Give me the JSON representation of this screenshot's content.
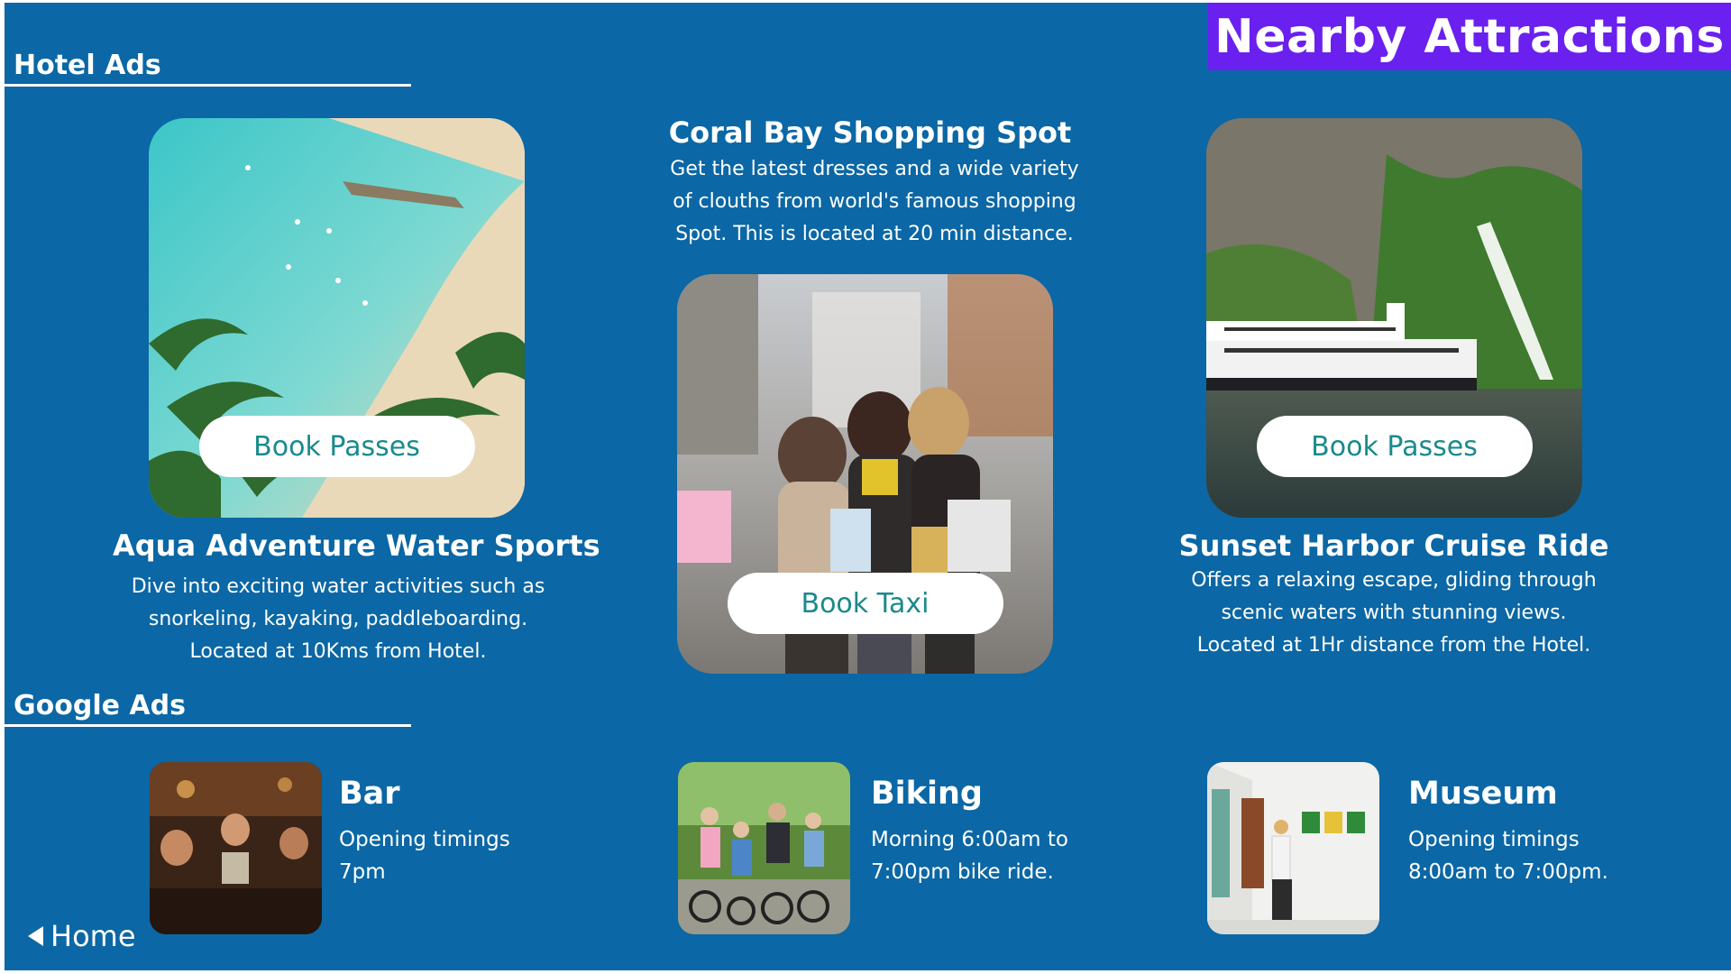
{
  "header": {
    "banner_title": "Nearby Attractions"
  },
  "sections": {
    "hotel_ads": "Hotel Ads",
    "google_ads": "Google Ads"
  },
  "hotel_ads": [
    {
      "title": "Aqua Adventure Water Sports",
      "description": "Dive into exciting water activities such as snorkeling, kayaking, paddleboarding. Located at 10Kms from Hotel.",
      "button": "Book Passes"
    },
    {
      "title": "Coral Bay Shopping Spot",
      "description": "Get the latest dresses and a wide variety of clouths from world's famous shopping Spot. This is located at 20 min distance.",
      "button": "Book Taxi"
    },
    {
      "title": "Sunset Harbor Cruise Ride",
      "description": "Offers a relaxing escape, gliding through scenic waters with stunning views. Located at 1Hr distance from the Hotel.",
      "button": "Book Passes"
    }
  ],
  "google_ads": [
    {
      "title": "Bar",
      "line1": "Opening timings",
      "line2": "7pm"
    },
    {
      "title": "Biking",
      "line1": "Morning 6:00am to",
      "line2": "7:00pm bike ride."
    },
    {
      "title": "Museum",
      "line1": "Opening timings",
      "line2": "8:00am to 7:00pm."
    }
  ],
  "nav": {
    "home_label": "Home"
  },
  "colors": {
    "background": "#0b67a5",
    "banner": "#6a20ee",
    "button_text": "#1a8a8c"
  }
}
